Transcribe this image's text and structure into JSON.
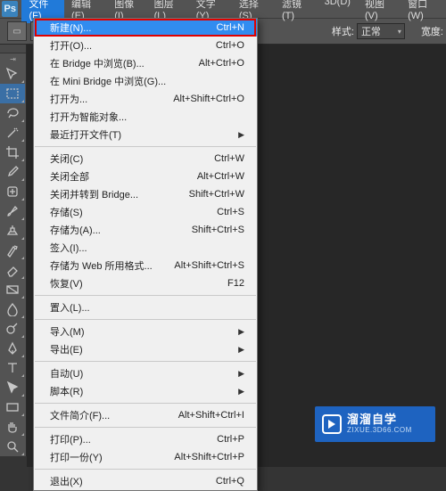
{
  "app": {
    "logo": "Ps"
  },
  "menubar": [
    {
      "label": "文件(F)",
      "active": true
    },
    {
      "label": "编辑(E)"
    },
    {
      "label": "图像(I)"
    },
    {
      "label": "图层(L)"
    },
    {
      "label": "文字(Y)"
    },
    {
      "label": "选择(S)"
    },
    {
      "label": "滤镜(T)"
    },
    {
      "label": "3D(D)"
    },
    {
      "label": "视图(V)"
    },
    {
      "label": "窗口(W)"
    }
  ],
  "optionsbar": {
    "style_label": "样式:",
    "style_value": "正常",
    "width_label": "宽度:"
  },
  "dropdown": {
    "groups": [
      [
        {
          "label": "新建(N)...",
          "shortcut": "Ctrl+N",
          "highlight": true,
          "boxed": true
        },
        {
          "label": "打开(O)...",
          "shortcut": "Ctrl+O"
        },
        {
          "label": "在 Bridge 中浏览(B)...",
          "shortcut": "Alt+Ctrl+O"
        },
        {
          "label": "在 Mini Bridge 中浏览(G)..."
        },
        {
          "label": "打开为...",
          "shortcut": "Alt+Shift+Ctrl+O"
        },
        {
          "label": "打开为智能对象..."
        },
        {
          "label": "最近打开文件(T)",
          "submenu": true
        }
      ],
      [
        {
          "label": "关闭(C)",
          "shortcut": "Ctrl+W"
        },
        {
          "label": "关闭全部",
          "shortcut": "Alt+Ctrl+W"
        },
        {
          "label": "关闭并转到 Bridge...",
          "shortcut": "Shift+Ctrl+W"
        },
        {
          "label": "存储(S)",
          "shortcut": "Ctrl+S"
        },
        {
          "label": "存储为(A)...",
          "shortcut": "Shift+Ctrl+S"
        },
        {
          "label": "签入(I)..."
        },
        {
          "label": "存储为 Web 所用格式...",
          "shortcut": "Alt+Shift+Ctrl+S"
        },
        {
          "label": "恢复(V)",
          "shortcut": "F12"
        }
      ],
      [
        {
          "label": "置入(L)..."
        }
      ],
      [
        {
          "label": "导入(M)",
          "submenu": true
        },
        {
          "label": "导出(E)",
          "submenu": true
        }
      ],
      [
        {
          "label": "自动(U)",
          "submenu": true
        },
        {
          "label": "脚本(R)",
          "submenu": true
        }
      ],
      [
        {
          "label": "文件简介(F)...",
          "shortcut": "Alt+Shift+Ctrl+I"
        }
      ],
      [
        {
          "label": "打印(P)...",
          "shortcut": "Ctrl+P"
        },
        {
          "label": "打印一份(Y)",
          "shortcut": "Alt+Shift+Ctrl+P"
        }
      ],
      [
        {
          "label": "退出(X)",
          "shortcut": "Ctrl+Q"
        }
      ]
    ]
  },
  "tools": [
    {
      "name": "move-tool"
    },
    {
      "name": "marquee-tool",
      "selected": true
    },
    {
      "name": "lasso-tool"
    },
    {
      "name": "magic-wand-tool"
    },
    {
      "name": "crop-tool"
    },
    {
      "name": "eyedropper-tool"
    },
    {
      "name": "healing-brush-tool"
    },
    {
      "name": "brush-tool"
    },
    {
      "name": "clone-stamp-tool"
    },
    {
      "name": "history-brush-tool"
    },
    {
      "name": "eraser-tool"
    },
    {
      "name": "gradient-tool"
    },
    {
      "name": "blur-tool"
    },
    {
      "name": "dodge-tool"
    },
    {
      "name": "pen-tool"
    },
    {
      "name": "type-tool"
    },
    {
      "name": "path-selection-tool"
    },
    {
      "name": "rectangle-tool"
    },
    {
      "name": "hand-tool"
    },
    {
      "name": "zoom-tool"
    }
  ],
  "watermark": {
    "cn": "溜溜自学",
    "en": "ZIXUE.3D66.COM"
  }
}
